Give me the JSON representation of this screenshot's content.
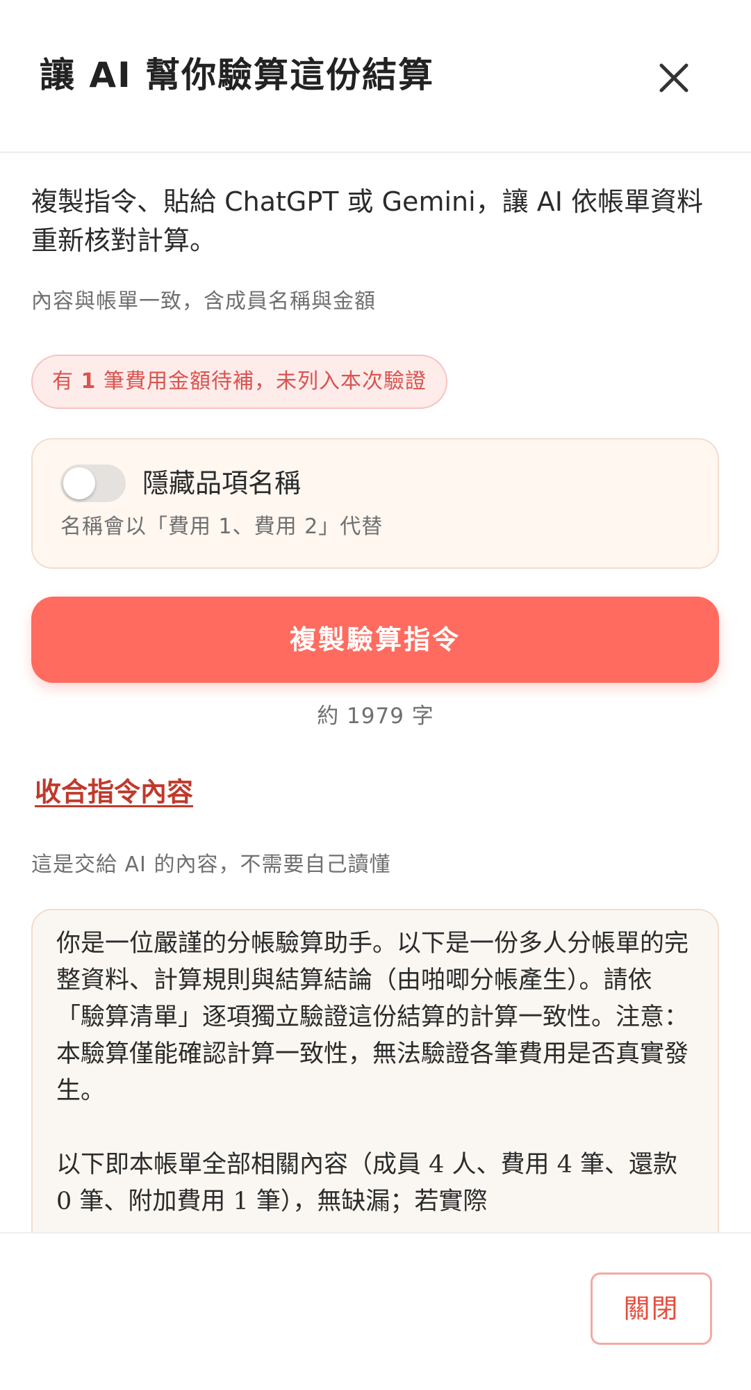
{
  "dialog": {
    "title": "讓 AI 幫你驗算這份結算"
  },
  "intro": {
    "text": "複製指令、貼給 ChatGPT 或 Gemini，讓 AI 依帳單資料重新核對計算。",
    "consistency_note": "內容與帳單一致，含成員名稱與金額"
  },
  "warning": {
    "prefix": "有 ",
    "count": "1",
    "suffix": " 筆費用金額待補，未列入本次驗證"
  },
  "hide_names": {
    "label": "隱藏品項名稱",
    "hint": "名稱會以「費用 1、費用 2」代替",
    "enabled": false
  },
  "copy_button": {
    "label": "複製驗算指令"
  },
  "char_count": "約 1979 字",
  "collapse_link": "收合指令內容",
  "ai_note": "這是交給 AI 的內容，不需要自己讀懂",
  "prompt": {
    "text": "你是一位嚴謹的分帳驗算助手。以下是一份多人分帳單的完整資料、計算規則與結算結論（由啪唧分帳產生）。請依「驗算清單」逐項獨立驗證這份結算的計算一致性。注意：本驗算僅能確認計算一致性，無法驗證各筆費用是否真實發生。\n\n以下即本帳單全部相關內容（成員 4 人、費用 4 筆、還款 0 筆、附加費用 1 筆），無缺漏；若實際"
  },
  "footer": {
    "close_label": "關閉"
  },
  "colors": {
    "accent": "#ff6b5f",
    "warning_text": "#d9534f",
    "link": "#c0392b"
  }
}
